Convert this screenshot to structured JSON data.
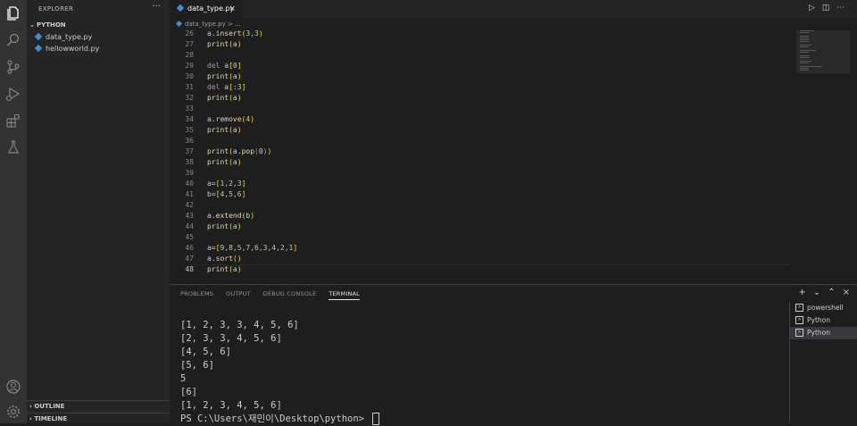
{
  "sidebar": {
    "title": "EXPLORER",
    "more": "···",
    "folder": "PYTHON",
    "files": [
      {
        "name": "data_type.py"
      },
      {
        "name": "hellowworld.py"
      }
    ],
    "outline": "OUTLINE",
    "timeline": "TIMELINE"
  },
  "tab": {
    "label": "data_type.py",
    "close": "×"
  },
  "breadcrumb": {
    "file": "data_type.py",
    "sep": "> ..."
  },
  "editor": {
    "lines": [
      {
        "n": "26",
        "code": [
          [
            "a",
            ".",
            "t-var"
          ],
          [
            ".insert",
            "",
            "t-fn"
          ],
          [
            "(",
            "",
            "t-br"
          ],
          [
            "3,3",
            "",
            "t-num"
          ],
          [
            ")",
            "",
            "t-br"
          ]
        ]
      },
      {
        "n": "27",
        "code": [
          [
            "print",
            "",
            "t-fn"
          ],
          [
            "(",
            "",
            "t-br"
          ],
          [
            "a",
            "",
            "t-var"
          ],
          [
            ")",
            "",
            "t-br"
          ]
        ]
      },
      {
        "n": "28",
        "code": []
      },
      {
        "n": "29",
        "code": [
          [
            "del ",
            "",
            "t-kw"
          ],
          [
            "a",
            "",
            "t-var"
          ],
          [
            "[",
            "",
            "t-br"
          ],
          [
            "0",
            "",
            "t-num"
          ],
          [
            "]",
            "",
            "t-br"
          ]
        ]
      },
      {
        "n": "30",
        "code": [
          [
            "print",
            "",
            "t-fn"
          ],
          [
            "(",
            "",
            "t-br"
          ],
          [
            "a",
            "",
            "t-var"
          ],
          [
            ")",
            "",
            "t-br"
          ]
        ]
      },
      {
        "n": "31",
        "code": [
          [
            "del ",
            "",
            "t-kw"
          ],
          [
            "a",
            "",
            "t-var"
          ],
          [
            "[",
            "",
            "t-br"
          ],
          [
            ":3",
            "",
            "t-num"
          ],
          [
            "]",
            "",
            "t-br"
          ]
        ]
      },
      {
        "n": "32",
        "code": [
          [
            "print",
            "",
            "t-fn"
          ],
          [
            "(",
            "",
            "t-br"
          ],
          [
            "a",
            "",
            "t-var"
          ],
          [
            ")",
            "",
            "t-br"
          ]
        ]
      },
      {
        "n": "33",
        "code": []
      },
      {
        "n": "34",
        "code": [
          [
            "a",
            "",
            "t-var"
          ],
          [
            ".remove",
            "",
            "t-fn"
          ],
          [
            "(",
            "",
            "t-br"
          ],
          [
            "4",
            "",
            "t-num"
          ],
          [
            ")",
            "",
            "t-br"
          ]
        ]
      },
      {
        "n": "35",
        "code": [
          [
            "print",
            "",
            "t-fn"
          ],
          [
            "(",
            "",
            "t-br"
          ],
          [
            "a",
            "",
            "t-var"
          ],
          [
            ")",
            "",
            "t-br"
          ]
        ]
      },
      {
        "n": "36",
        "code": []
      },
      {
        "n": "37",
        "code": [
          [
            "print",
            "",
            "t-fn"
          ],
          [
            "(",
            "",
            "t-br"
          ],
          [
            "a",
            "",
            "t-var"
          ],
          [
            ".pop",
            "",
            "t-fn"
          ],
          [
            "(",
            "",
            "t-br2"
          ],
          [
            "0",
            "",
            "t-num"
          ],
          [
            ")",
            "",
            "t-br2"
          ],
          [
            ")",
            "",
            "t-br"
          ]
        ]
      },
      {
        "n": "38",
        "code": [
          [
            "print",
            "",
            "t-fn"
          ],
          [
            "(",
            "",
            "t-br"
          ],
          [
            "a",
            "",
            "t-var"
          ],
          [
            ")",
            "",
            "t-br"
          ]
        ]
      },
      {
        "n": "39",
        "code": []
      },
      {
        "n": "40",
        "code": [
          [
            "a",
            "",
            "t-var"
          ],
          [
            "=",
            "",
            "t-p"
          ],
          [
            "[",
            "",
            "t-br"
          ],
          [
            "1,2,3",
            "",
            "t-num"
          ],
          [
            "]",
            "",
            "t-br"
          ]
        ]
      },
      {
        "n": "41",
        "code": [
          [
            "b",
            "",
            "t-var"
          ],
          [
            "=",
            "",
            "t-p"
          ],
          [
            "[",
            "",
            "t-br"
          ],
          [
            "4,5,6",
            "",
            "t-num"
          ],
          [
            "]",
            "",
            "t-br"
          ]
        ]
      },
      {
        "n": "42",
        "code": []
      },
      {
        "n": "43",
        "code": [
          [
            "a",
            "",
            "t-var"
          ],
          [
            ".extend",
            "",
            "t-fn"
          ],
          [
            "(",
            "",
            "t-br"
          ],
          [
            "b",
            "",
            "t-var"
          ],
          [
            ")",
            "",
            "t-br"
          ]
        ]
      },
      {
        "n": "44",
        "code": [
          [
            "print",
            "",
            "t-fn"
          ],
          [
            "(",
            "",
            "t-br"
          ],
          [
            "a",
            "",
            "t-var"
          ],
          [
            ")",
            "",
            "t-br"
          ]
        ]
      },
      {
        "n": "45",
        "code": []
      },
      {
        "n": "46",
        "code": [
          [
            "a",
            "",
            "t-var"
          ],
          [
            "=",
            "",
            "t-p"
          ],
          [
            "[",
            "",
            "t-br"
          ],
          [
            "9,8,5,7,6,3,4,2,1",
            "",
            "t-num"
          ],
          [
            "]",
            "",
            "t-br"
          ]
        ]
      },
      {
        "n": "47",
        "code": [
          [
            "a",
            "",
            "t-var"
          ],
          [
            ".sort",
            "",
            "t-fn"
          ],
          [
            "(",
            "",
            "t-br"
          ],
          [
            ")",
            "",
            "t-br"
          ]
        ]
      },
      {
        "n": "48",
        "code": [
          [
            "print",
            "",
            "t-fn"
          ],
          [
            "(",
            "",
            "t-br"
          ],
          [
            "a",
            "",
            "t-var"
          ],
          [
            ")",
            "",
            "t-br"
          ]
        ]
      }
    ]
  },
  "panel": {
    "tabs": [
      "PROBLEMS",
      "OUTPUT",
      "DEBUG CONSOLE",
      "TERMINAL"
    ],
    "active_tab": 3,
    "actions": [
      "+",
      "⌄",
      "⌃",
      "×"
    ]
  },
  "terminal": {
    "lines": [
      "[1, 2, 3, 3, 4, 5, 6]",
      "[2, 3, 3, 4, 5, 6]",
      "[4, 5, 6]",
      "[5, 6]",
      "5",
      "[6]",
      "[1, 2, 3, 4, 5, 6]"
    ],
    "prompt": "PS C:\\Users\\재민이\\Desktop\\python> "
  },
  "terminal_list": [
    {
      "label": "powershell",
      "active": false
    },
    {
      "label": "Python",
      "active": false
    },
    {
      "label": "Python",
      "active": true
    }
  ]
}
